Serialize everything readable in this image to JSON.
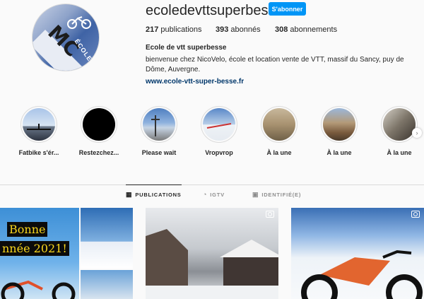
{
  "profile": {
    "username": "ecoledevttsuperbesse",
    "follow_label": "S'abonner",
    "stats": {
      "publications": "217",
      "publications_label": "publications",
      "followers": "393",
      "followers_label": "abonnés",
      "following": "308",
      "following_label": "abonnements"
    },
    "full_name": "Ecole de vtt superbesse",
    "bio": "bienvenue chez NicoVelo, école et location vente de VTT, massif du Sancy, puy de Dôme, Auvergne.",
    "website": "www.ecole-vtt-super-besse.fr",
    "avatar_text": "ÉCOLE"
  },
  "highlights": [
    {
      "label": "Fatbike s'ér..."
    },
    {
      "label": "Restezchez..."
    },
    {
      "label": "Please wait"
    },
    {
      "label": "Vropvrop"
    },
    {
      "label": "À la une"
    },
    {
      "label": "À la une"
    },
    {
      "label": "À la une"
    }
  ],
  "tabs": [
    {
      "label": "PUBLICATIONS",
      "icon": "grid-icon",
      "active": true
    },
    {
      "label": "IGTV",
      "icon": "igtv-icon",
      "active": false
    },
    {
      "label": "IDENTIFIÉ(E)",
      "icon": "tagged-icon",
      "active": false
    }
  ],
  "posts": [
    {
      "text_line1": "Bonne",
      "text_line2": "nnée 2021!"
    },
    {},
    {}
  ],
  "colors": {
    "accent": "#0095f6",
    "link": "#00376b",
    "background": "#fafafa"
  }
}
